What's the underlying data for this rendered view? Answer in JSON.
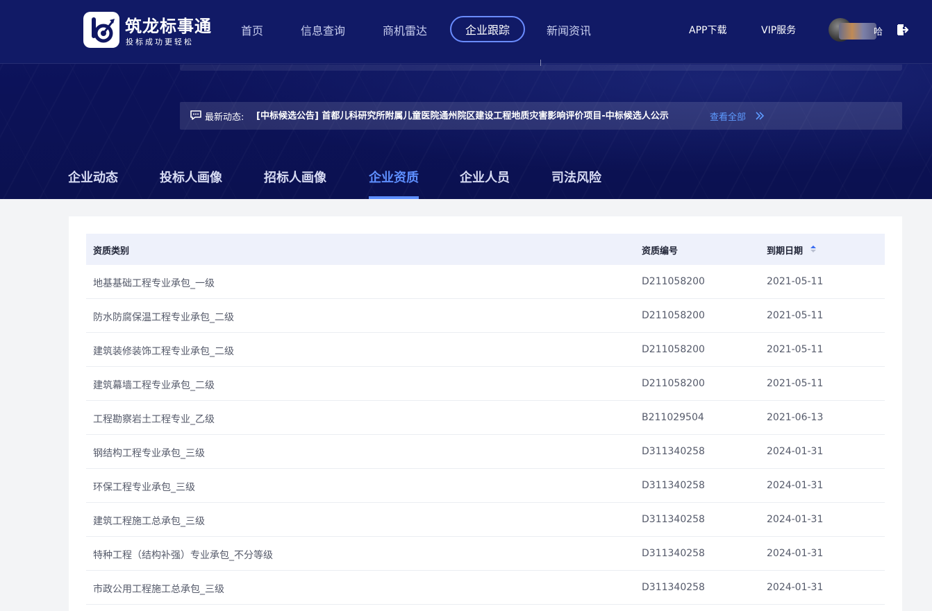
{
  "header": {
    "logo_text": "筑龙标事通",
    "logo_slogan": "投标成功更轻松",
    "nav": [
      "首页",
      "信息查询",
      "商机雷达",
      "企业跟踪",
      "新闻资讯"
    ],
    "nav_active_index": 3,
    "app_download": "APP下载",
    "vip": "VIP服务",
    "user_name_tail": "哈"
  },
  "news": {
    "label": "最新动态:",
    "text": "[中标候选公告]  首都儿科研究所附属儿童医院通州院区建设工程地质灾害影响评价项目-中标候选人公示",
    "more": "查看全部"
  },
  "tabs": [
    "企业动态",
    "投标人画像",
    "招标人画像",
    "企业资质",
    "企业人员",
    "司法风险"
  ],
  "tabs_active_index": 3,
  "table": {
    "columns": [
      "资质类别",
      "资质编号",
      "到期日期"
    ],
    "rows": [
      [
        "地基基础工程专业承包_一级",
        "D211058200",
        "2021-05-11"
      ],
      [
        "防水防腐保温工程专业承包_二级",
        "D211058200",
        "2021-05-11"
      ],
      [
        "建筑装修装饰工程专业承包_二级",
        "D211058200",
        "2021-05-11"
      ],
      [
        "建筑幕墙工程专业承包_二级",
        "D211058200",
        "2021-05-11"
      ],
      [
        "工程勘察岩土工程专业_乙级",
        "B211029504",
        "2021-06-13"
      ],
      [
        "钢结构工程专业承包_三级",
        "D311340258",
        "2024-01-31"
      ],
      [
        "环保工程专业承包_三级",
        "D311340258",
        "2024-01-31"
      ],
      [
        "建筑工程施工总承包_三级",
        "D311340258",
        "2024-01-31"
      ],
      [
        "特种工程（结构补强）专业承包_不分等级",
        "D311340258",
        "2024-01-31"
      ],
      [
        "市政公用工程施工总承包_三级",
        "D311340258",
        "2024-01-31"
      ]
    ]
  },
  "colors": {
    "header_bg": "#111a66",
    "hero_bg": "#0c1259",
    "accent": "#5e8fff",
    "link": "#5e9bff",
    "table_head_bg": "#eef1fb"
  }
}
